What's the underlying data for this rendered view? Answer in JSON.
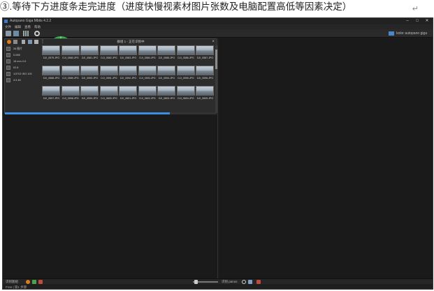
{
  "caption": {
    "text": "③.等待下方进度条走完进度（进度快慢视素材图片张数及电脑配置高低等因素决定）",
    "return_mark": "↵"
  },
  "window": {
    "title": "Autopano Giga Mbits 4.2.2",
    "minimize": "–",
    "maximize": "□",
    "close": "✕"
  },
  "menu": [
    "文件",
    "编辑",
    "查看",
    "帮助"
  ],
  "brand": "kolor autopano giga",
  "image_panel": {
    "title": "群组 1 - 正在识别中",
    "close": "×",
    "more": "⋮"
  },
  "info": [
    {
      "icon": "image-count-icon",
      "text": "26 图片"
    },
    {
      "icon": "camera-icon",
      "text": "DJI00"
    },
    {
      "icon": "focal-icon",
      "text": "16 mm 4:3"
    },
    {
      "icon": "aperture-icon",
      "text": "f/2.8"
    },
    {
      "icon": "exposure-icon",
      "text": "1/3702 ISO 100"
    },
    {
      "icon": "size-icon",
      "text": "4:3 4K"
    }
  ],
  "thumbnails": [
    [
      "DJI_0579.JPG",
      "DJI_0580.JPG",
      "DJI_0581.JPG",
      "DJI_0582.JPG",
      "DJI_0583.JPG",
      "DJI_0584.JPG",
      "DJI_0585.JPG",
      "DJI_0586.JPG",
      "DJI_0587.JPG"
    ],
    [
      "DJI_0588.JPG",
      "DJI_0589.JPG",
      "DJI_0590.JPG",
      "DJI_0591.JPG",
      "DJI_0592.JPG",
      "DJI_0593.JPG",
      "DJI_0594.JPG",
      "DJI_0595.JPG",
      "DJI_0596.JPG"
    ],
    [
      "DJI_0597.JPG",
      "DJI_0598.JPG",
      "DJI_0599.JPG",
      "DJI_0600.JPG",
      "DJI_0601.JPG",
      "DJI_0602.JPG",
      "DJI_0603.JPG",
      "DJI_0604.JPG",
      "DJI_0605.JPG"
    ]
  ],
  "progress": 0.78,
  "bottom": {
    "left_label": "识别图组",
    "right_label": "识别 panos"
  },
  "status": "Free | 第1 步骤",
  "colors": {
    "accent_progress": "#3c8fe0",
    "orange": "#e07b1c",
    "green": "#4aa34a",
    "red": "#c24a3a"
  }
}
